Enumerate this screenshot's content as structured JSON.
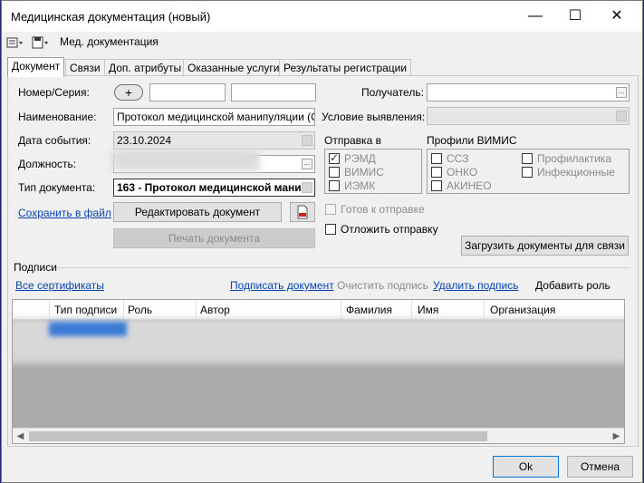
{
  "window": {
    "title": "Медицинская документация (новый)",
    "controls": {
      "minimize": "—",
      "maximize": "☐",
      "close": "✕"
    }
  },
  "toolbar": {
    "menu_label": "Мед. документация"
  },
  "tabs": [
    {
      "label": "Документ",
      "active": true
    },
    {
      "label": "Связи"
    },
    {
      "label": "Доп. атрибуты"
    },
    {
      "label": "Оказанные услуги"
    },
    {
      "label": "Результаты регистрации"
    }
  ],
  "form": {
    "number_series_label": "Номер/Серия:",
    "plus_button": "+",
    "name_label": "Наименование:",
    "name_value": "Протокол медицинской манипуляции (CDA",
    "event_date_label": "Дата события:",
    "event_date_value": "23.10.2024",
    "position_label": "Должность:",
    "doc_type_label": "Тип документа:",
    "doc_type_value": "163 - Протокол медицинской мани",
    "save_to_file_link": "Сохранить в файл",
    "edit_document_button": "Редактировать документ",
    "print_document_button": "Печать документа",
    "recipient_label": "Получатель:",
    "detection_condition_label": "Условие выявления:",
    "send_to_label": "Отправка в",
    "send_to_options": [
      {
        "label": "РЭМД",
        "checked": true
      },
      {
        "label": "ВИМИС",
        "checked": false
      },
      {
        "label": "ИЭМК",
        "checked": false
      }
    ],
    "vimis_profiles_label": "Профили ВИМИС",
    "vimis_profiles_col1": [
      "ССЗ",
      "ОНКО",
      "АКИНЕО"
    ],
    "vimis_profiles_col2": [
      "Профилактика",
      "Инфекционные"
    ],
    "ready_to_send_label": "Готов к отправке",
    "postpone_send_label": "Отложить отправку",
    "load_docs_button": "Загрузить документы для связи"
  },
  "signatures": {
    "section_label": "Подписи",
    "all_certificates_link": "Все сертификаты",
    "sign_document_link": "Подписать документ",
    "clear_signature_label": "Очистить подпись",
    "delete_signature_link": "Удалить подпись",
    "add_role_button": "Добавить роль",
    "columns": [
      "Тип подписи",
      "Роль",
      "Автор",
      "Фамилия",
      "Имя",
      "Организация"
    ]
  },
  "footer": {
    "ok_button": "Ok",
    "cancel_button": "Отмена"
  },
  "icons": {
    "toolbar_icon_1": "list-dropdown-icon",
    "toolbar_icon_2": "save-dropdown-icon",
    "pdf_icon": "pdf-file-icon"
  }
}
